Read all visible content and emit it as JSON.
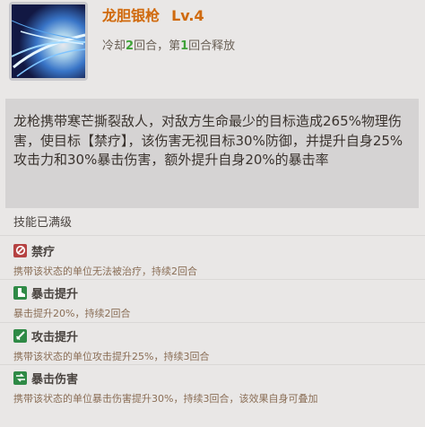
{
  "skill": {
    "icon": "spear-slash-icon",
    "name": "龙胆银枪",
    "level": "Lv.4",
    "cooldown_prefix": "冷却",
    "cooldown_value": "2",
    "cooldown_mid": "回合，第",
    "release_value": "1",
    "cooldown_suffix": "回合释放",
    "description": "龙枪携带寒芒撕裂敌人，对敌方生命最少的目标造成265%物理伤害，使目标【禁疗】，该伤害无视目标30%防御，并提升自身25%攻击力和30%暴击伤害，额外提升自身20%的暴击率",
    "maxed_label": "技能已满级"
  },
  "colors": {
    "title": "#cf6a10",
    "highlight_number": "#3fa238",
    "status_desc": "#8a6e56"
  },
  "statuses": [
    {
      "icon": "no-heal-icon",
      "name": "禁疗",
      "desc": "携带该状态的单位无法被治疗，持续2回合",
      "color": "#b54242"
    },
    {
      "icon": "boot-icon",
      "name": "暴击提升",
      "desc": "暴击提升20%，持续2回合",
      "color": "#2f8a46"
    },
    {
      "icon": "sword-icon",
      "name": "攻击提升",
      "desc": "携带该状态的单位攻击提升25%，持续3回合",
      "color": "#2f8a46"
    },
    {
      "icon": "crit-damage-icon",
      "name": "暴击伤害",
      "desc": "携带该状态的单位暴击伤害提升30%，持续3回合，该效果自身可叠加",
      "color": "#2f8a46"
    }
  ]
}
